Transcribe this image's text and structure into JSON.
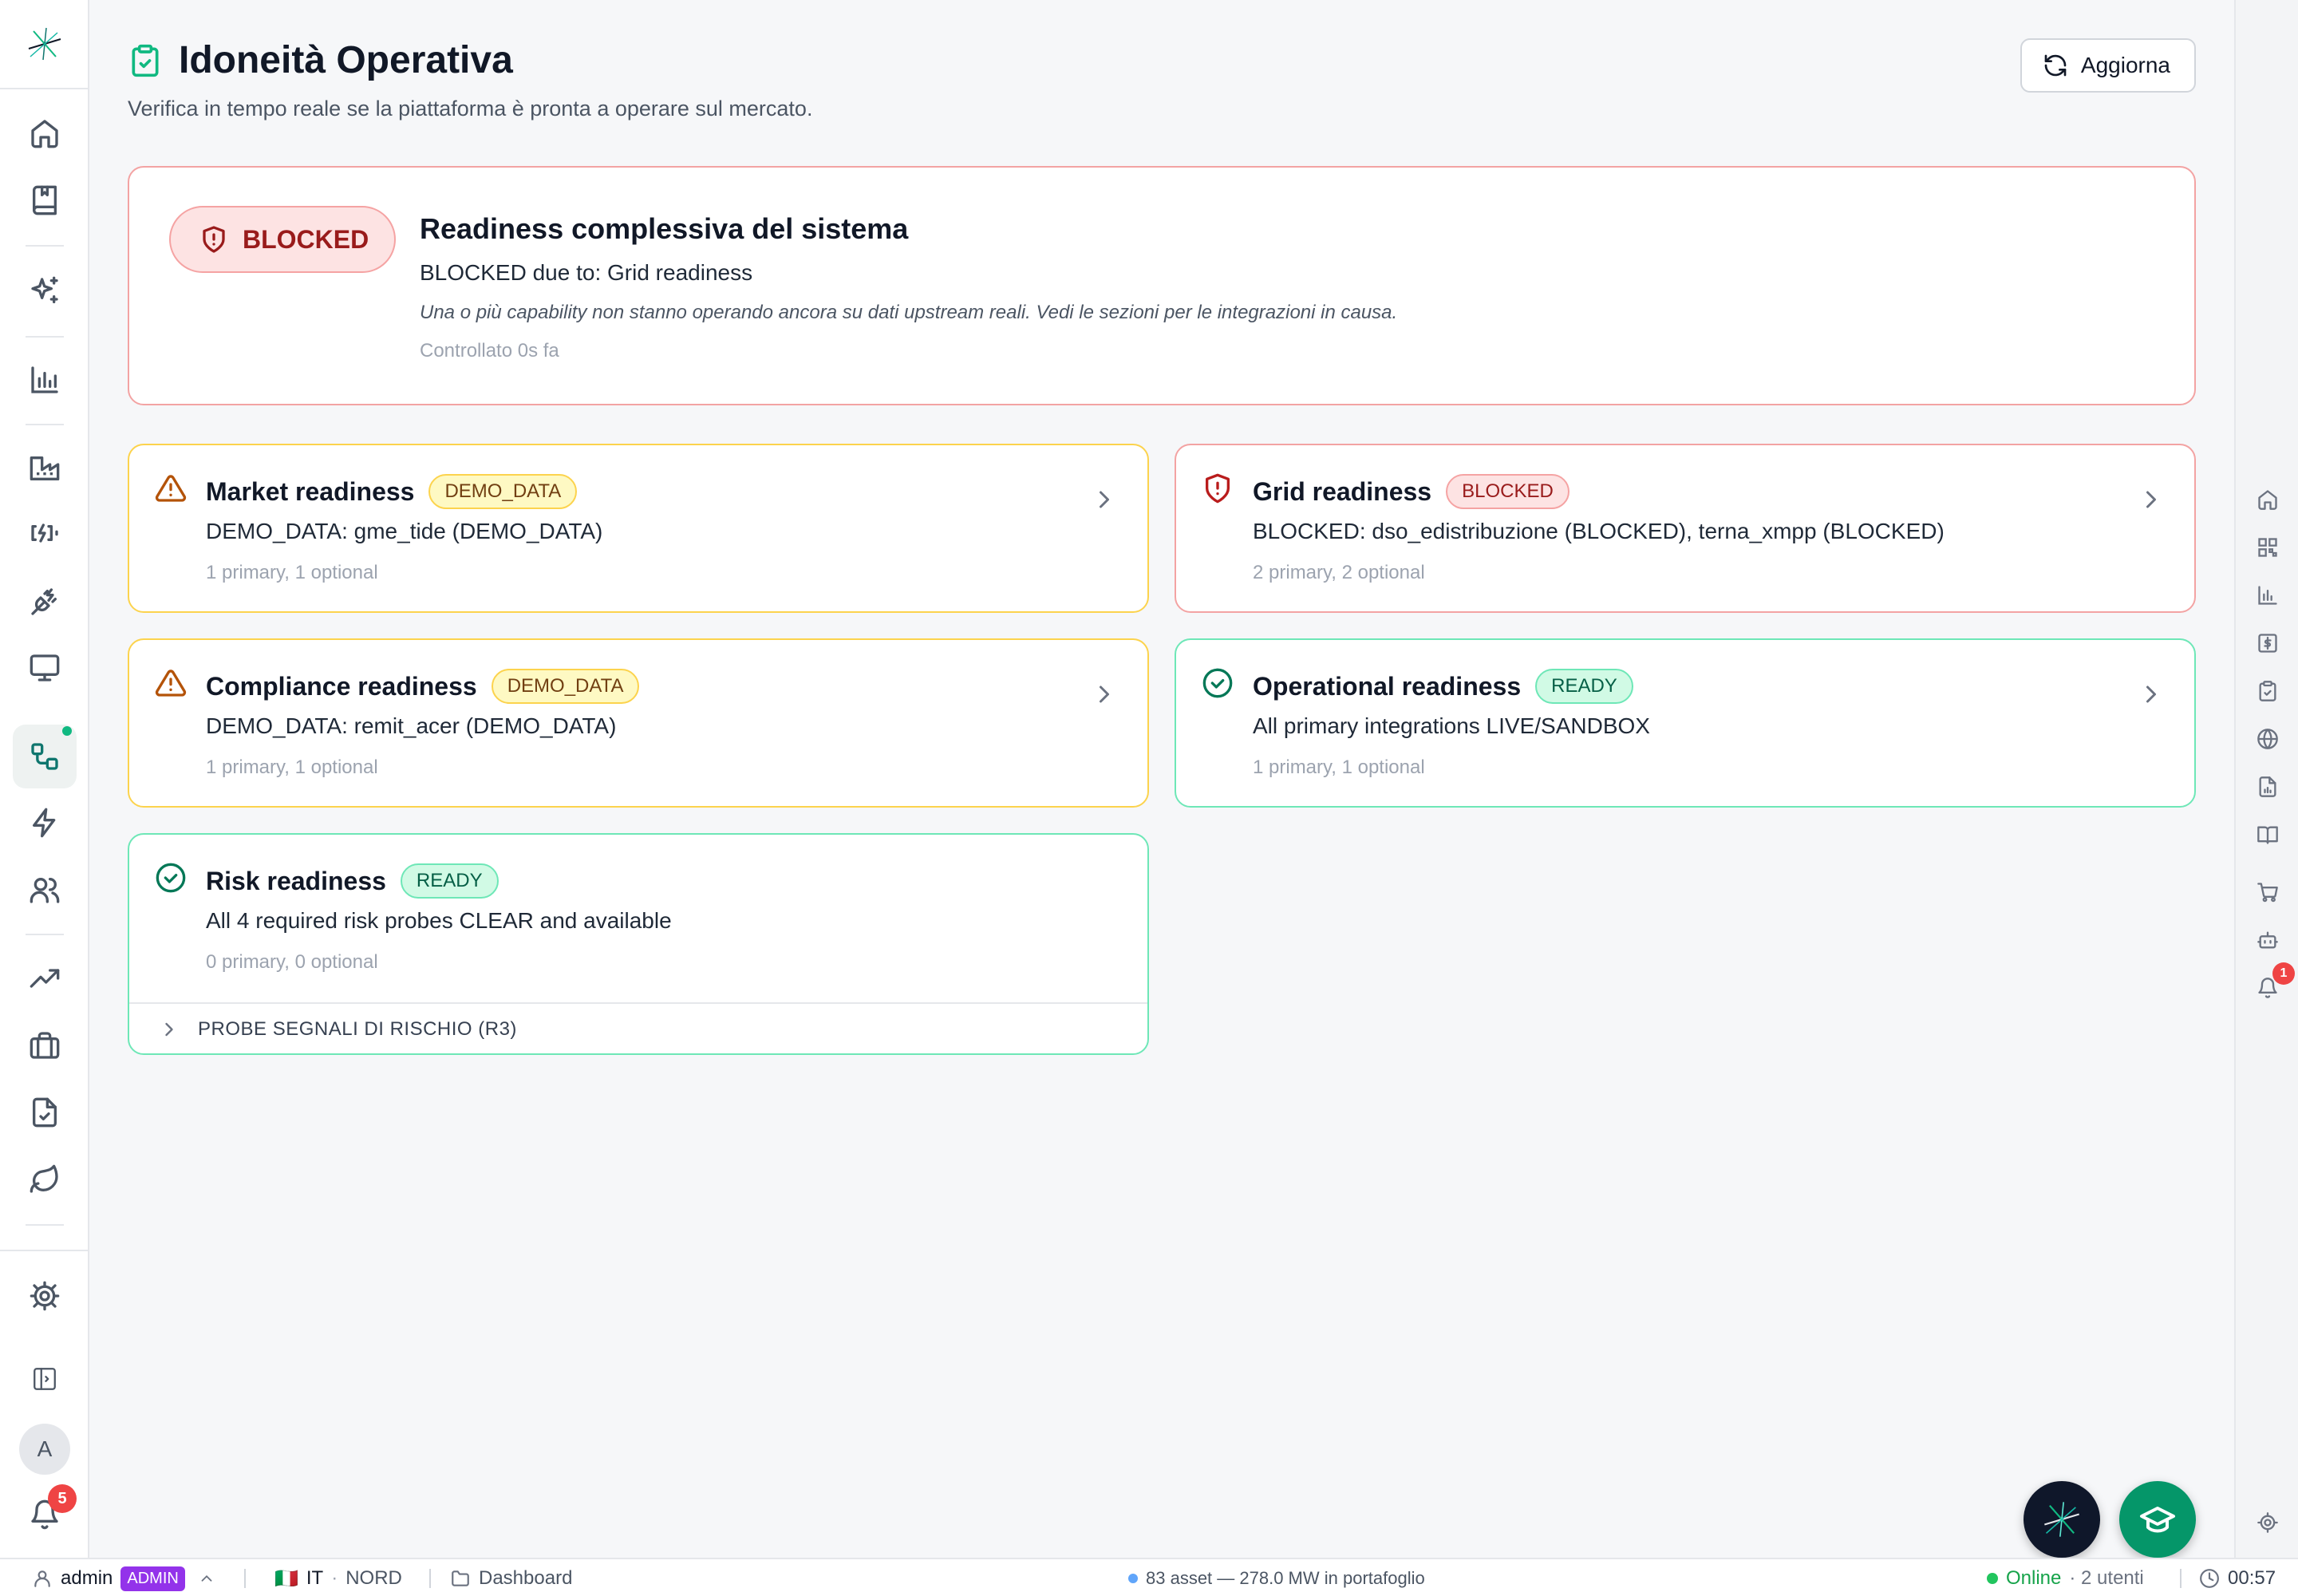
{
  "page": {
    "title": "Idoneità Operativa",
    "subtitle": "Verifica in tempo reale se la piattaforma è pronta a operare sul mercato.",
    "refresh_label": "Aggiorna"
  },
  "overall": {
    "status": "BLOCKED",
    "title": "Readiness complessiva del sistema",
    "reason": "BLOCKED due to: Grid readiness",
    "note": "Una o più capability non stanno operando ancora su dati upstream reali. Vedi le sezioni per le integrazioni in causa.",
    "checked": "Controllato 0s fa"
  },
  "cards": [
    {
      "title": "Market readiness",
      "status": "DEMO_DATA",
      "desc": "DEMO_DATA: gme_tide (DEMO_DATA)",
      "meta": "1 primary, 1 optional"
    },
    {
      "title": "Grid readiness",
      "status": "BLOCKED",
      "desc": "BLOCKED: dso_edistribuzione (BLOCKED), terna_xmpp (BLOCKED)",
      "meta": "2 primary, 2 optional"
    },
    {
      "title": "Compliance readiness",
      "status": "DEMO_DATA",
      "desc": "DEMO_DATA: remit_acer (DEMO_DATA)",
      "meta": "1 primary, 1 optional"
    },
    {
      "title": "Operational readiness",
      "status": "READY",
      "desc": "All primary integrations LIVE/SANDBOX",
      "meta": "1 primary, 1 optional"
    },
    {
      "title": "Risk readiness",
      "status": "READY",
      "desc": "All 4 required risk probes CLEAR and available",
      "meta": "0 primary, 0 optional",
      "expander": "PROBE SEGNALI DI RISCHIO (R3)"
    }
  ],
  "sidebar": {
    "avatar_letter": "A",
    "notifications_count": "5",
    "icons": [
      "home-icon",
      "book-icon",
      "sparkles-icon",
      "bar-chart-icon",
      "factory-icon",
      "battery-charging-icon",
      "plug-icon",
      "monitor-icon",
      "workflow-icon",
      "zap-icon",
      "users-icon",
      "trending-up-icon",
      "briefcase-icon",
      "file-check-icon",
      "leaf-icon",
      "settings-icon",
      "panel-toggle-icon",
      "bell-icon"
    ]
  },
  "right_rail": {
    "icons": [
      "home-icon",
      "dashboard-icon",
      "bar-chart-icon",
      "dollar-icon",
      "clipboard-check-icon",
      "globe-icon",
      "file-chart-icon",
      "book-open-icon",
      "cart-icon",
      "bot-icon",
      "bell-icon",
      "settings-icon"
    ],
    "bell_count": "1"
  },
  "footer": {
    "user": "admin",
    "role": "ADMIN",
    "region_flag": "🇮🇹",
    "region": "IT",
    "zone": "NORD",
    "section": "Dashboard",
    "portfolio": "83 asset — 278.0 MW in portafoglio",
    "online": "Online",
    "users": "· 2 utenti",
    "time": "00:57"
  },
  "colors": {
    "accent": "#10b981",
    "blocked": "#991b1b",
    "warn": "#b45309",
    "ready": "#059669"
  }
}
